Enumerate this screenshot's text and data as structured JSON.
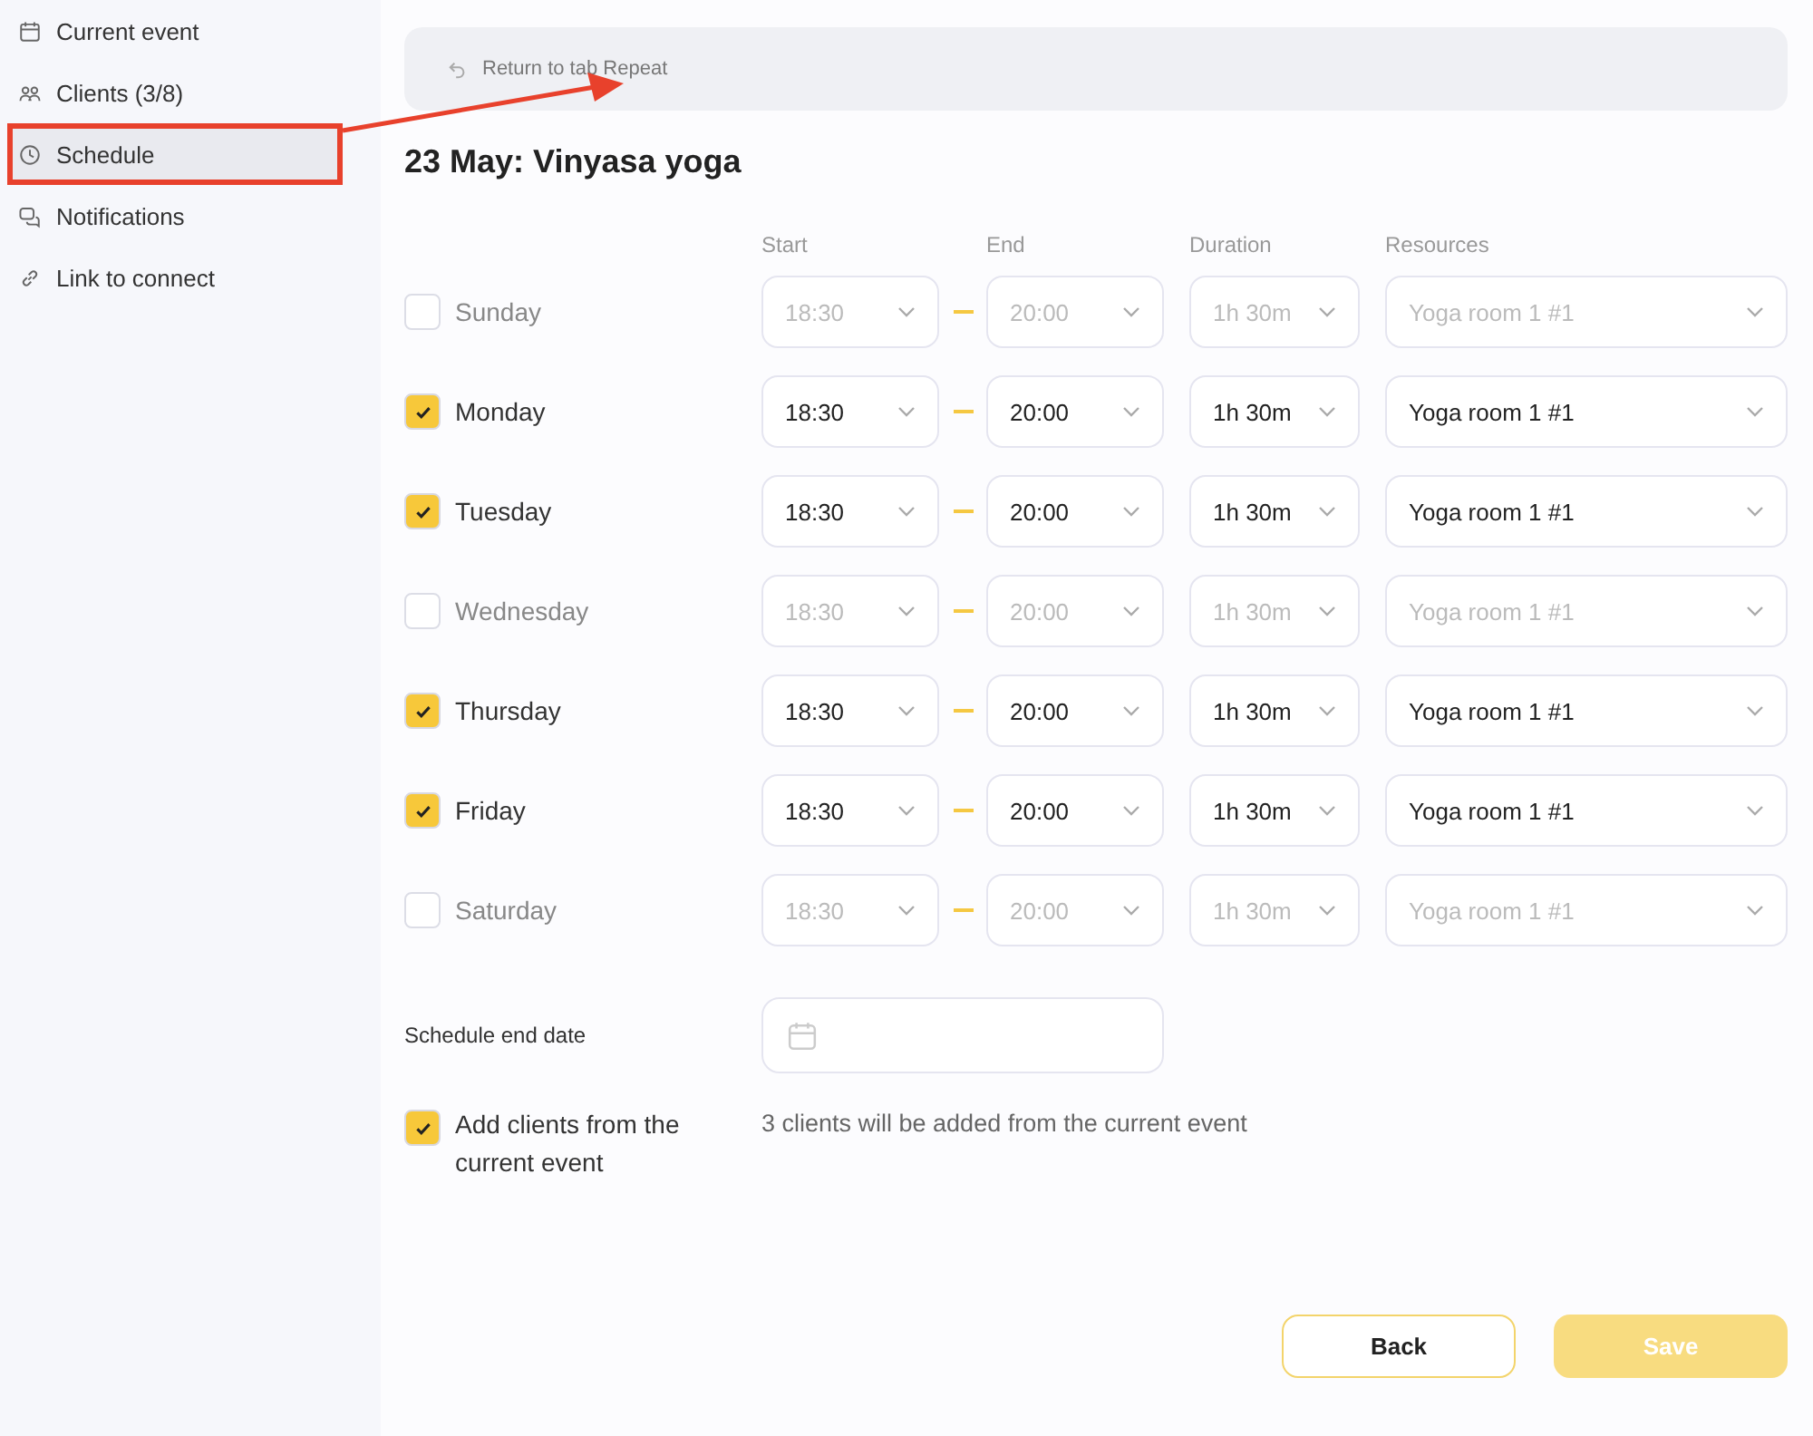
{
  "sidebar": {
    "items": [
      {
        "label": "Current event",
        "selected": false,
        "annotated": false
      },
      {
        "label": "Clients (3/8)",
        "selected": false,
        "annotated": false
      },
      {
        "label": "Schedule",
        "selected": true,
        "annotated": true
      },
      {
        "label": "Notifications",
        "selected": false,
        "annotated": false
      },
      {
        "label": "Link to connect",
        "selected": false,
        "annotated": false
      }
    ]
  },
  "banner": {
    "label": "Return to tab Repeat"
  },
  "title": "23 May: Vinyasa yoga",
  "columns": [
    "Start",
    "End",
    "Duration",
    "Resources"
  ],
  "days": [
    {
      "name": "Sunday",
      "checked": false,
      "start": "18:30",
      "end": "20:00",
      "duration": "1h 30m",
      "resource": "Yoga room 1 #1"
    },
    {
      "name": "Monday",
      "checked": true,
      "start": "18:30",
      "end": "20:00",
      "duration": "1h 30m",
      "resource": "Yoga room 1 #1"
    },
    {
      "name": "Tuesday",
      "checked": true,
      "start": "18:30",
      "end": "20:00",
      "duration": "1h 30m",
      "resource": "Yoga room 1 #1"
    },
    {
      "name": "Wednesday",
      "checked": false,
      "start": "18:30",
      "end": "20:00",
      "duration": "1h 30m",
      "resource": "Yoga room 1 #1"
    },
    {
      "name": "Thursday",
      "checked": true,
      "start": "18:30",
      "end": "20:00",
      "duration": "1h 30m",
      "resource": "Yoga room 1 #1"
    },
    {
      "name": "Friday",
      "checked": true,
      "start": "18:30",
      "end": "20:00",
      "duration": "1h 30m",
      "resource": "Yoga room 1 #1"
    },
    {
      "name": "Saturday",
      "checked": false,
      "start": "18:30",
      "end": "20:00",
      "duration": "1h 30m",
      "resource": "Yoga room 1 #1"
    }
  ],
  "end_date": {
    "label": "Schedule end date"
  },
  "add_clients": {
    "label": "Add clients from the current event",
    "checked": true,
    "note": "3 clients will be added from the current event"
  },
  "buttons": {
    "back": "Back",
    "save": "Save"
  }
}
